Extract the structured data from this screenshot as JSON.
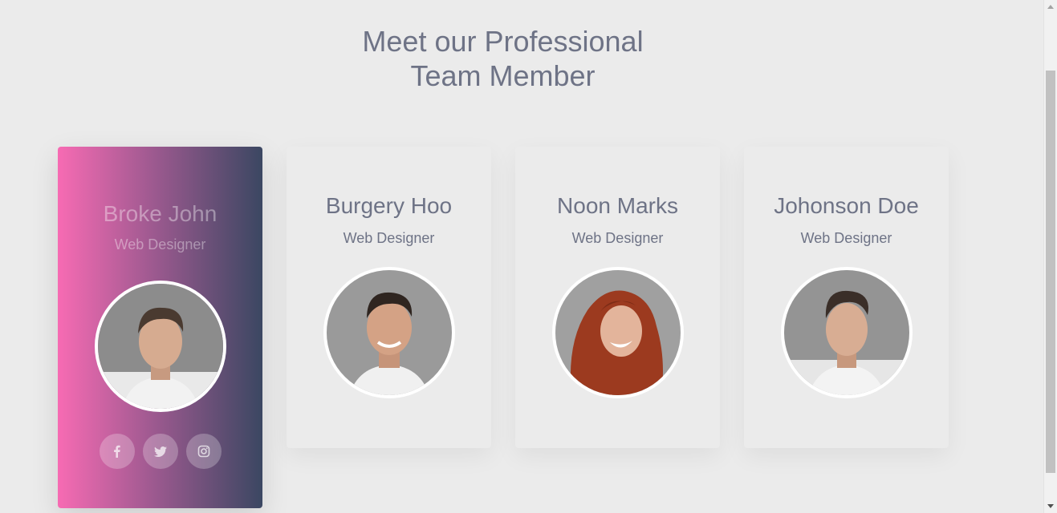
{
  "heading": {
    "line1": "Meet our Professional",
    "line2": "Team Member"
  },
  "team": [
    {
      "name": "Broke John",
      "role": "Web Designer",
      "active": true
    },
    {
      "name": "Burgery Hoo",
      "role": "Web Designer",
      "active": false
    },
    {
      "name": "Noon Marks",
      "role": "Web Designer",
      "active": false
    },
    {
      "name": "Johonson Doe",
      "role": "Web Designer",
      "active": false
    }
  ],
  "socials": [
    "facebook-icon",
    "twitter-icon",
    "instagram-icon"
  ],
  "colors": {
    "background": "#ebebeb",
    "text": "#6e7386",
    "gradient_start": "#f76bb3",
    "gradient_end": "#3b4762"
  }
}
